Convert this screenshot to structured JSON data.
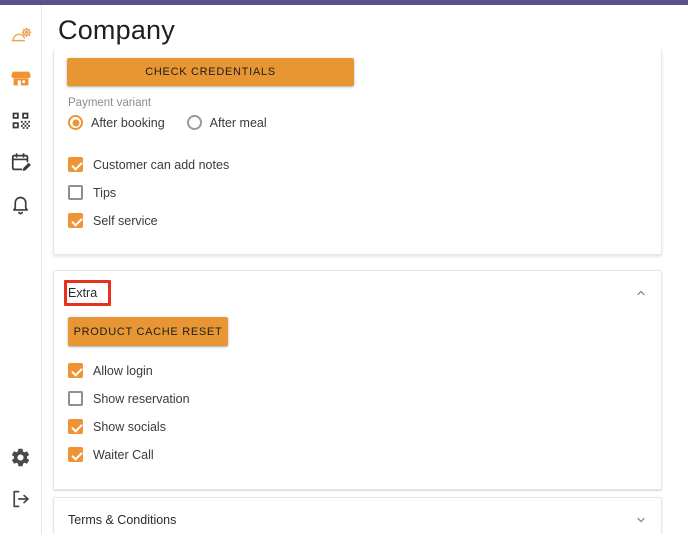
{
  "theme": {
    "topbar_color": "#5d4e8c",
    "accent_orange": "#e89634",
    "control_orange": "#ef9434",
    "highlight_red": "#e8311a"
  },
  "sidebar": {
    "top_items": [
      {
        "name": "service-dome-settings-icon",
        "label": "Service settings",
        "active": true
      },
      {
        "name": "store-icon",
        "label": "Store",
        "active": true
      },
      {
        "name": "qr-code-icon",
        "label": "QR code",
        "active": false
      },
      {
        "name": "calendar-edit-icon",
        "label": "Bookings",
        "active": false
      },
      {
        "name": "bell-icon",
        "label": "Notifications",
        "active": false
      }
    ],
    "bottom_items": [
      {
        "name": "gear-icon",
        "label": "Settings"
      },
      {
        "name": "logout-icon",
        "label": "Log out"
      }
    ]
  },
  "page": {
    "title": "Company"
  },
  "payment_panel": {
    "check_credentials_label": "CHECK CREDENTIALS",
    "payment_variant_label": "Payment variant",
    "payment_variant_options": [
      {
        "label": "After booking",
        "selected": true
      },
      {
        "label": "After meal",
        "selected": false
      }
    ],
    "checkboxes": [
      {
        "label": "Customer can add notes",
        "checked": true
      },
      {
        "label": "Tips",
        "checked": false
      },
      {
        "label": "Self service",
        "checked": true
      }
    ]
  },
  "extra_panel": {
    "header_title": "Extra",
    "expanded": true,
    "chevron": "chevron-up",
    "highlighted": true,
    "product_cache_reset_label": "PRODUCT CACHE RESET",
    "checkboxes": [
      {
        "label": "Allow login",
        "checked": true
      },
      {
        "label": "Show reservation",
        "checked": false
      },
      {
        "label": "Show socials",
        "checked": true
      },
      {
        "label": "Waiter Call",
        "checked": true
      }
    ]
  },
  "terms_panel": {
    "header_title": "Terms & Conditions",
    "expanded": false,
    "chevron": "chevron-down"
  }
}
